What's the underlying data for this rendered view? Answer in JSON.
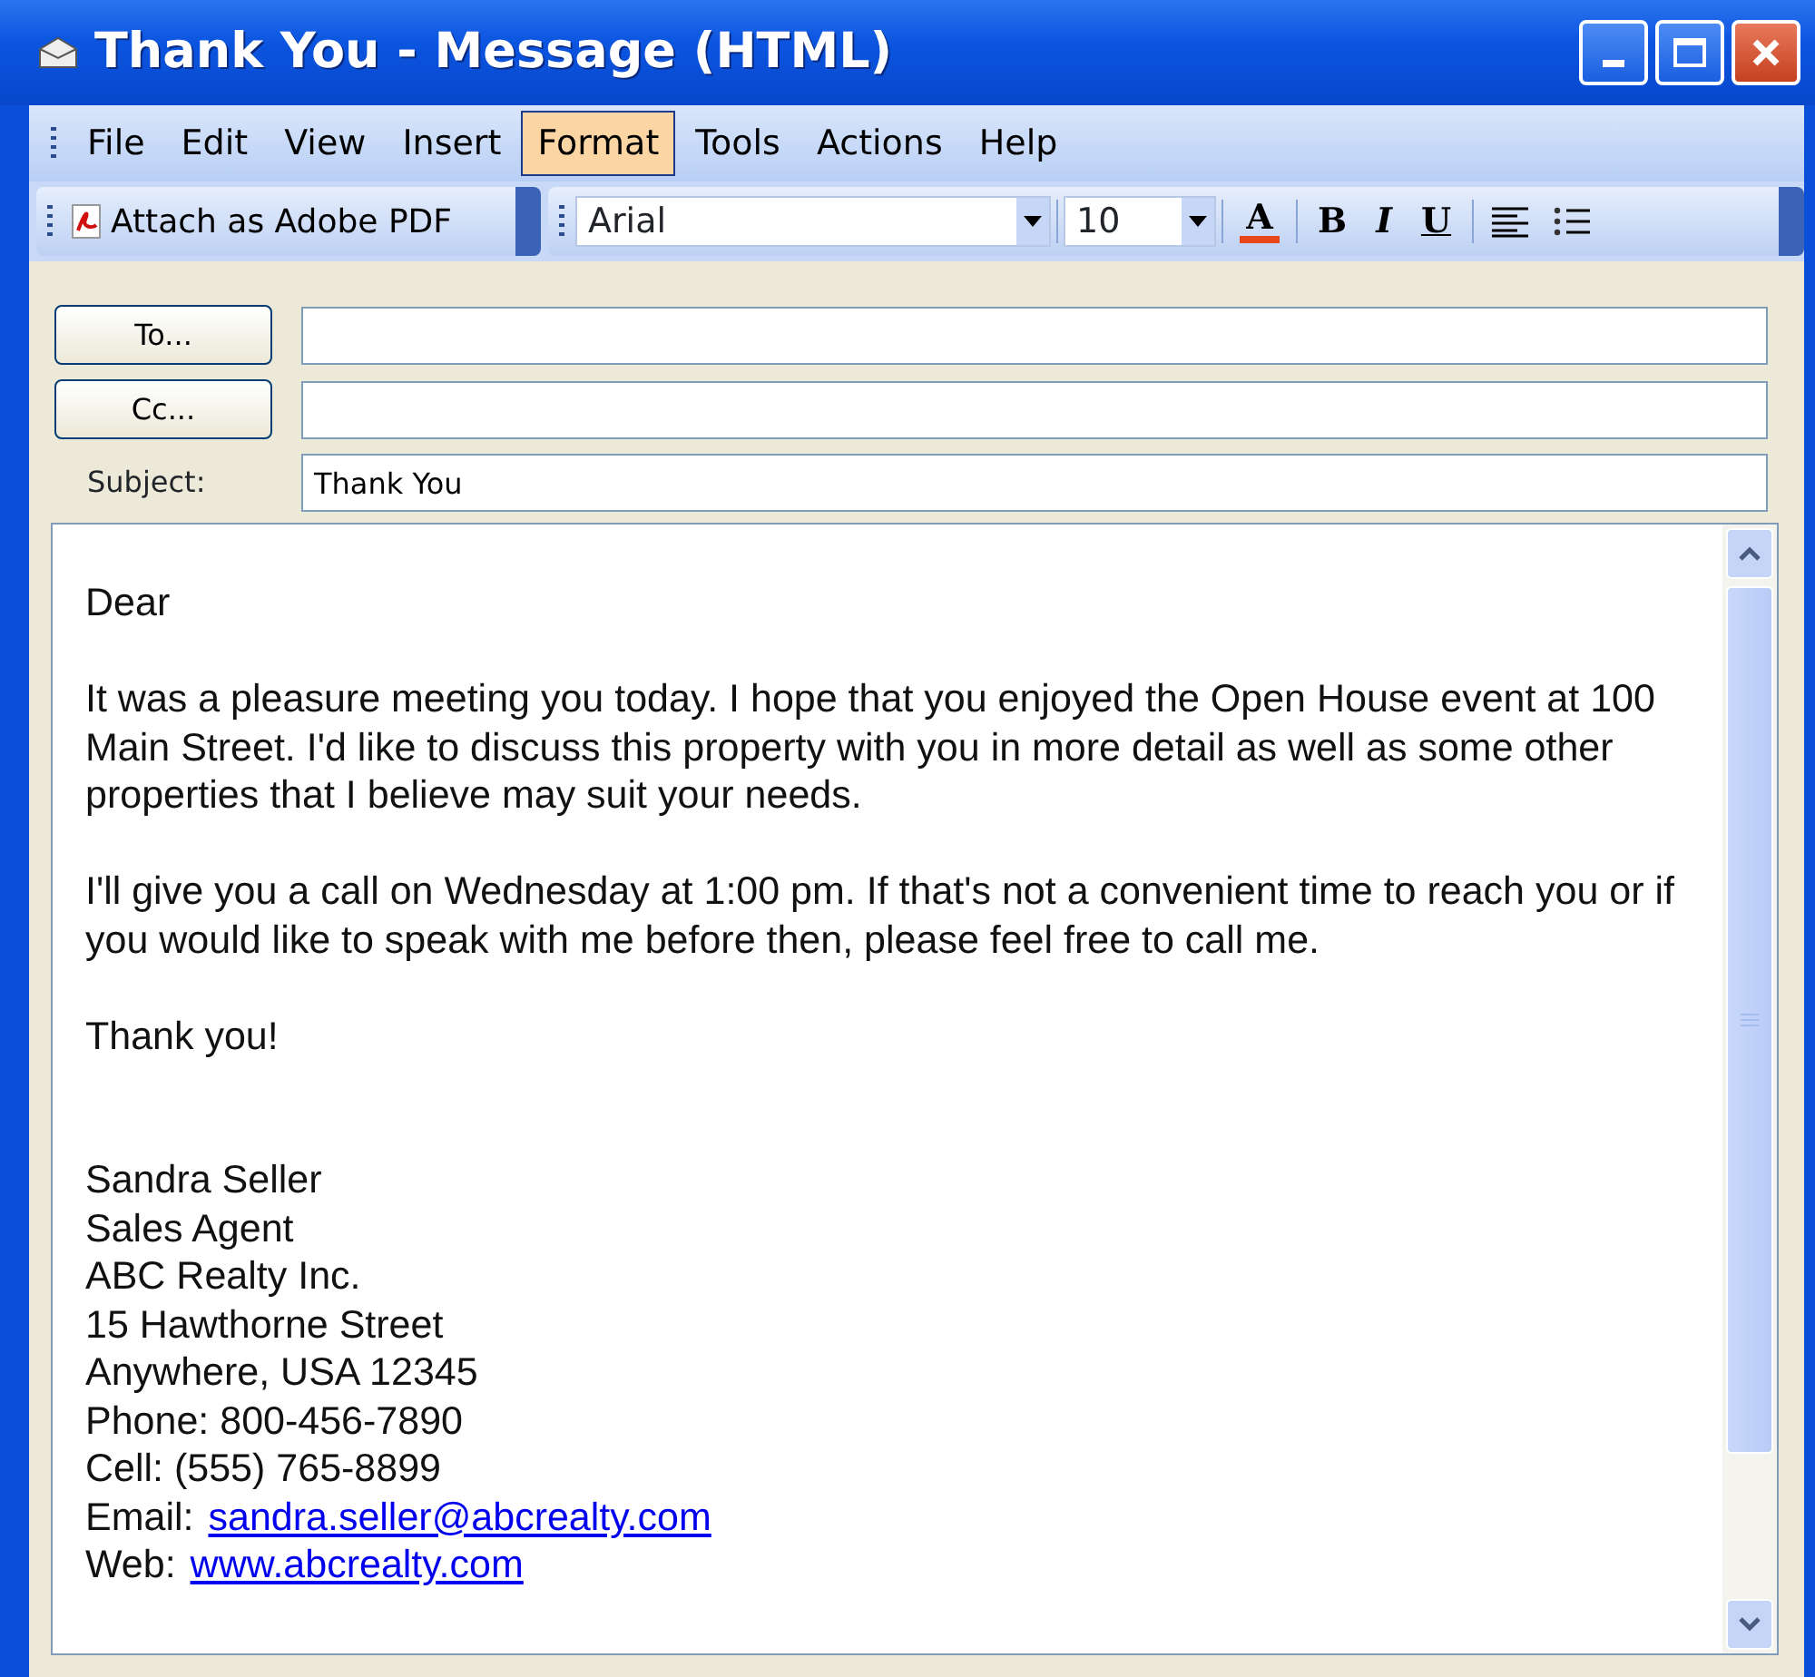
{
  "window": {
    "title": "Thank You - Message (HTML)"
  },
  "menu": [
    {
      "label": "File",
      "selected": false
    },
    {
      "label": "Edit",
      "selected": false
    },
    {
      "label": "View",
      "selected": false
    },
    {
      "label": "Insert",
      "selected": false
    },
    {
      "label": "Format",
      "selected": true
    },
    {
      "label": "Tools",
      "selected": false
    },
    {
      "label": "Actions",
      "selected": false
    },
    {
      "label": "Help",
      "selected": false
    }
  ],
  "toolbar": {
    "attach_button": "Attach as Adobe PDF",
    "font": "Arial",
    "size": "10",
    "font_color": {
      "label": "A",
      "color": "#e8471c"
    },
    "format_buttons": [
      {
        "label": "B",
        "kind": "bold"
      },
      {
        "label": "I",
        "kind": "italic"
      },
      {
        "label": "U",
        "kind": "underline"
      }
    ]
  },
  "header": {
    "to": {
      "button": "To..."
    },
    "cc": {
      "button": "Cc..."
    },
    "subject": {
      "label": "Subject:",
      "value": "Thank You"
    }
  },
  "body": {
    "paragraphs": [
      "Dear",
      "It was a pleasure meeting you today. I hope that you enjoyed the Open House event at 100 Main Street. I'd like to discuss this property with you in more detail as well as some other properties that I believe may suit your needs.",
      "I'll give you a call on Wednesday at 1:00 pm. If that's not a convenient time to reach you or if you would like to speak with me before then, please feel free to call me.",
      "Thank you!"
    ],
    "signature": [
      {
        "text": "Sandra Seller"
      },
      {
        "text": "Sales Agent"
      },
      {
        "text": "ABC Realty Inc."
      },
      {
        "text": "15 Hawthorne Street"
      },
      {
        "text": "Anywhere, USA 12345"
      },
      {
        "text": "Phone: 800-456-7890"
      },
      {
        "text": "Cell: (555) 765-8899"
      },
      {
        "text": "Email:",
        "link": "sandra.seller@abcrealty.com"
      },
      {
        "text": "Web:",
        "link": "www.abcrealty.com"
      }
    ]
  }
}
